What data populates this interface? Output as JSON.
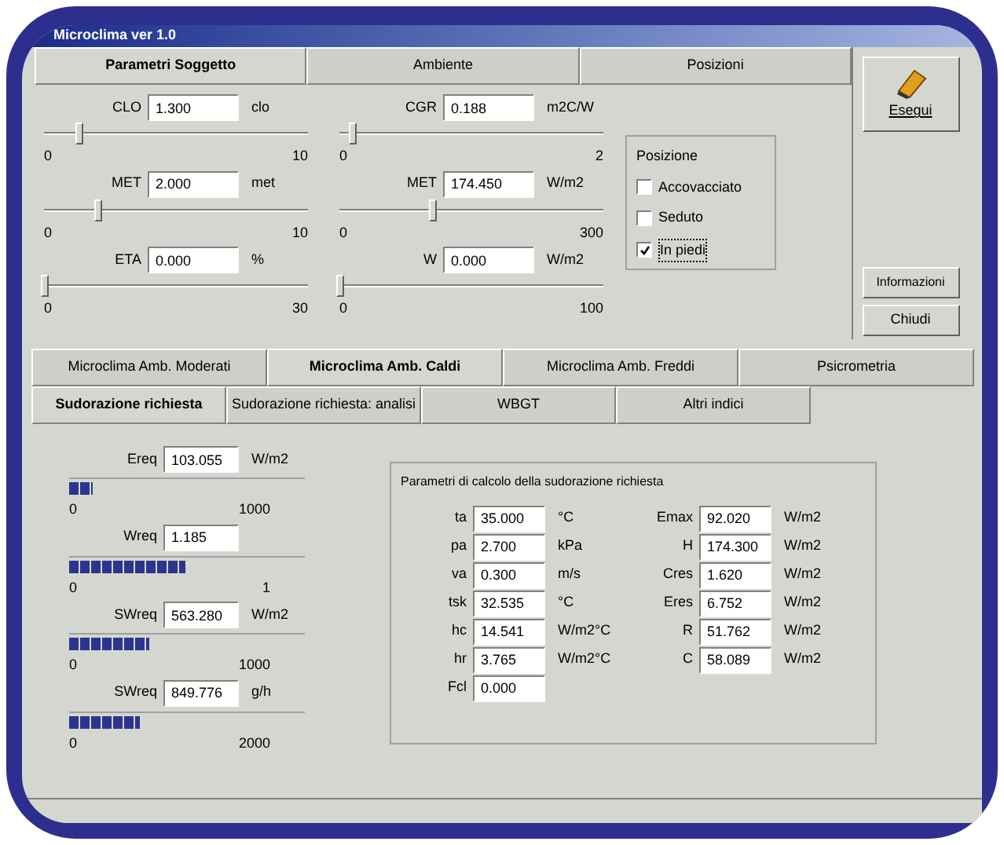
{
  "window": {
    "title": "Microclima ver 1.0"
  },
  "top_tabs": [
    {
      "label": "Parametri Soggetto",
      "selected": true
    },
    {
      "label": "Ambiente",
      "selected": false
    },
    {
      "label": "Posizioni",
      "selected": false
    }
  ],
  "sliders": [
    {
      "label": "CLO",
      "value": "1.300",
      "unit": "clo",
      "min": "0",
      "max": "10",
      "level": 0.13
    },
    {
      "label": "MET",
      "value": "2.000",
      "unit": "met",
      "min": "0",
      "max": "10",
      "level": 0.2
    },
    {
      "label": "ETA",
      "value": "0.000",
      "unit": "%",
      "min": "0",
      "max": "30",
      "level": 0
    },
    {
      "label": "CGR",
      "value": "0.188",
      "unit": "m2C/W",
      "min": "0",
      "max": "2",
      "level": 0.05
    },
    {
      "label": "MET",
      "value": "174.450",
      "unit": "W/m2",
      "min": "0",
      "max": "300",
      "level": 0.35
    },
    {
      "label": "W",
      "value": "0.000",
      "unit": "W/m2",
      "min": "0",
      "max": "100",
      "level": 0
    }
  ],
  "posture": {
    "title": "Posizione",
    "options": [
      {
        "label": "Accovacciato",
        "checked": false
      },
      {
        "label": "Seduto",
        "checked": false
      },
      {
        "label": "In piedi",
        "checked": true
      }
    ]
  },
  "buttons": {
    "run": "Esegui",
    "info": "Informazioni",
    "close": "Chiudi"
  },
  "tabs_row1": [
    {
      "label": "Microclima Amb. Moderati",
      "selected": false
    },
    {
      "label": "Microclima Amb. Caldi",
      "selected": true
    },
    {
      "label": "Microclima Amb. Freddi",
      "selected": false
    },
    {
      "label": "Psicrometria",
      "selected": false
    }
  ],
  "tabs_row2": [
    {
      "label": "Sudorazione richiesta",
      "selected": true
    },
    {
      "label": "Sudorazione richiesta: analisi",
      "selected": false
    },
    {
      "label": "WBGT",
      "selected": false
    },
    {
      "label": "Altri indici",
      "selected": false
    }
  ],
  "meters": [
    {
      "label": "Ereq",
      "value": "103.055",
      "unit": "W/m2",
      "min": "0",
      "max": "1000",
      "level": 0.12
    },
    {
      "label": "Wreq",
      "value": "1.185",
      "min": "0",
      "max": "1",
      "level": 0.58
    },
    {
      "label": "SWreq",
      "value": "563.280",
      "unit": "W/m2",
      "min": "0",
      "max": "1000",
      "level": 0.4
    },
    {
      "label": "SWreq",
      "value": "849.776",
      "unit": "g/h",
      "min": "0",
      "max": "2000",
      "level": 0.35
    }
  ],
  "params": {
    "title": "Parametri di calcolo della sudorazione richiesta",
    "left": [
      {
        "label": "ta",
        "value": "35.000",
        "unit": "°C"
      },
      {
        "label": "pa",
        "value": "2.700",
        "unit": "kPa"
      },
      {
        "label": "va",
        "value": "0.300",
        "unit": "m/s"
      },
      {
        "label": "tsk",
        "value": "32.535",
        "unit": "°C"
      },
      {
        "label": "hc",
        "value": "14.541",
        "unit": "W/m2°C"
      },
      {
        "label": "hr",
        "value": "3.765",
        "unit": "W/m2°C"
      },
      {
        "label": "Fcl",
        "value": "0.000"
      }
    ],
    "right": [
      {
        "label": "Emax",
        "value": "92.020",
        "unit": "W/m2"
      },
      {
        "label": "H",
        "value": "174.300",
        "unit": "W/m2"
      },
      {
        "label": "Cres",
        "value": "1.620",
        "unit": "W/m2"
      },
      {
        "label": "Eres",
        "value": "6.752",
        "unit": "W/m2"
      },
      {
        "label": "R",
        "value": "51.762",
        "unit": "W/m2"
      },
      {
        "label": "C",
        "value": "58.089",
        "unit": "W/m2"
      }
    ]
  }
}
